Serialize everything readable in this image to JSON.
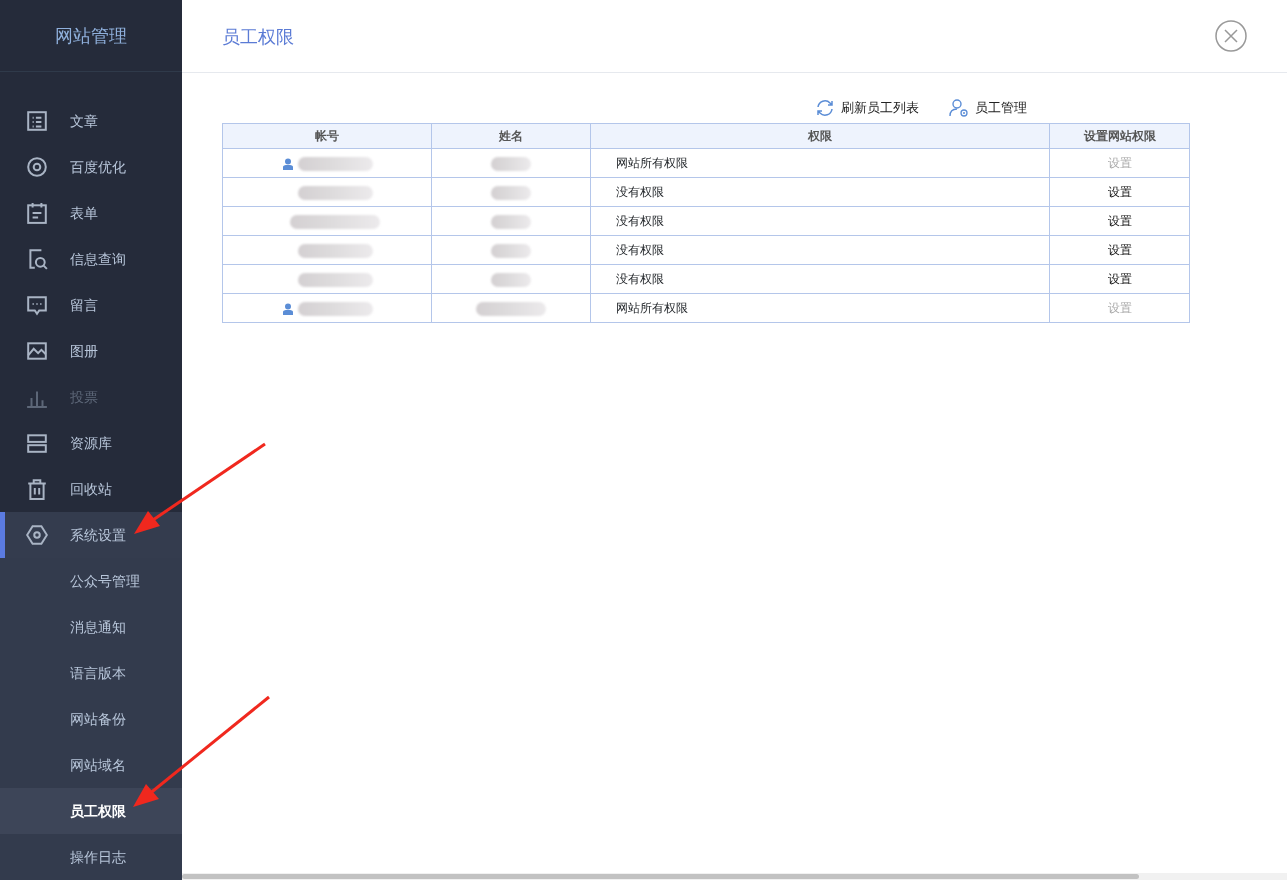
{
  "sidebar": {
    "title": "网站管理",
    "items": [
      {
        "label": "文章",
        "disabled": false,
        "selected": false
      },
      {
        "label": "百度优化",
        "disabled": false,
        "selected": false
      },
      {
        "label": "表单",
        "disabled": false,
        "selected": false
      },
      {
        "label": "信息查询",
        "disabled": false,
        "selected": false
      },
      {
        "label": "留言",
        "disabled": false,
        "selected": false
      },
      {
        "label": "图册",
        "disabled": false,
        "selected": false
      },
      {
        "label": "投票",
        "disabled": true,
        "selected": false
      },
      {
        "label": "资源库",
        "disabled": false,
        "selected": false
      },
      {
        "label": "回收站",
        "disabled": false,
        "selected": false
      },
      {
        "label": "系统设置",
        "disabled": false,
        "selected": true,
        "children": [
          {
            "label": "公众号管理",
            "selected": false
          },
          {
            "label": "消息通知",
            "selected": false
          },
          {
            "label": "语言版本",
            "selected": false
          },
          {
            "label": "网站备份",
            "selected": false
          },
          {
            "label": "网站域名",
            "selected": false
          },
          {
            "label": "员工权限",
            "selected": true
          },
          {
            "label": "操作日志",
            "selected": false
          }
        ]
      }
    ]
  },
  "page": {
    "title": "员工权限"
  },
  "toolbar": [
    {
      "label": "刷新员工列表"
    },
    {
      "label": "员工管理"
    }
  ],
  "table": {
    "columns": [
      "帐号",
      "姓名",
      "权限",
      "设置网站权限"
    ],
    "rows": [
      {
        "admin": true,
        "permission": "网站所有权限",
        "action": "设置",
        "disabled": true
      },
      {
        "admin": false,
        "permission": "没有权限",
        "action": "设置",
        "disabled": false
      },
      {
        "admin": false,
        "permission": "没有权限",
        "action": "设置",
        "disabled": false
      },
      {
        "admin": false,
        "permission": "没有权限",
        "action": "设置",
        "disabled": false
      },
      {
        "admin": false,
        "permission": "没有权限",
        "action": "设置",
        "disabled": false
      },
      {
        "admin": true,
        "permission": "网站所有权限",
        "action": "设置",
        "disabled": true
      }
    ]
  }
}
